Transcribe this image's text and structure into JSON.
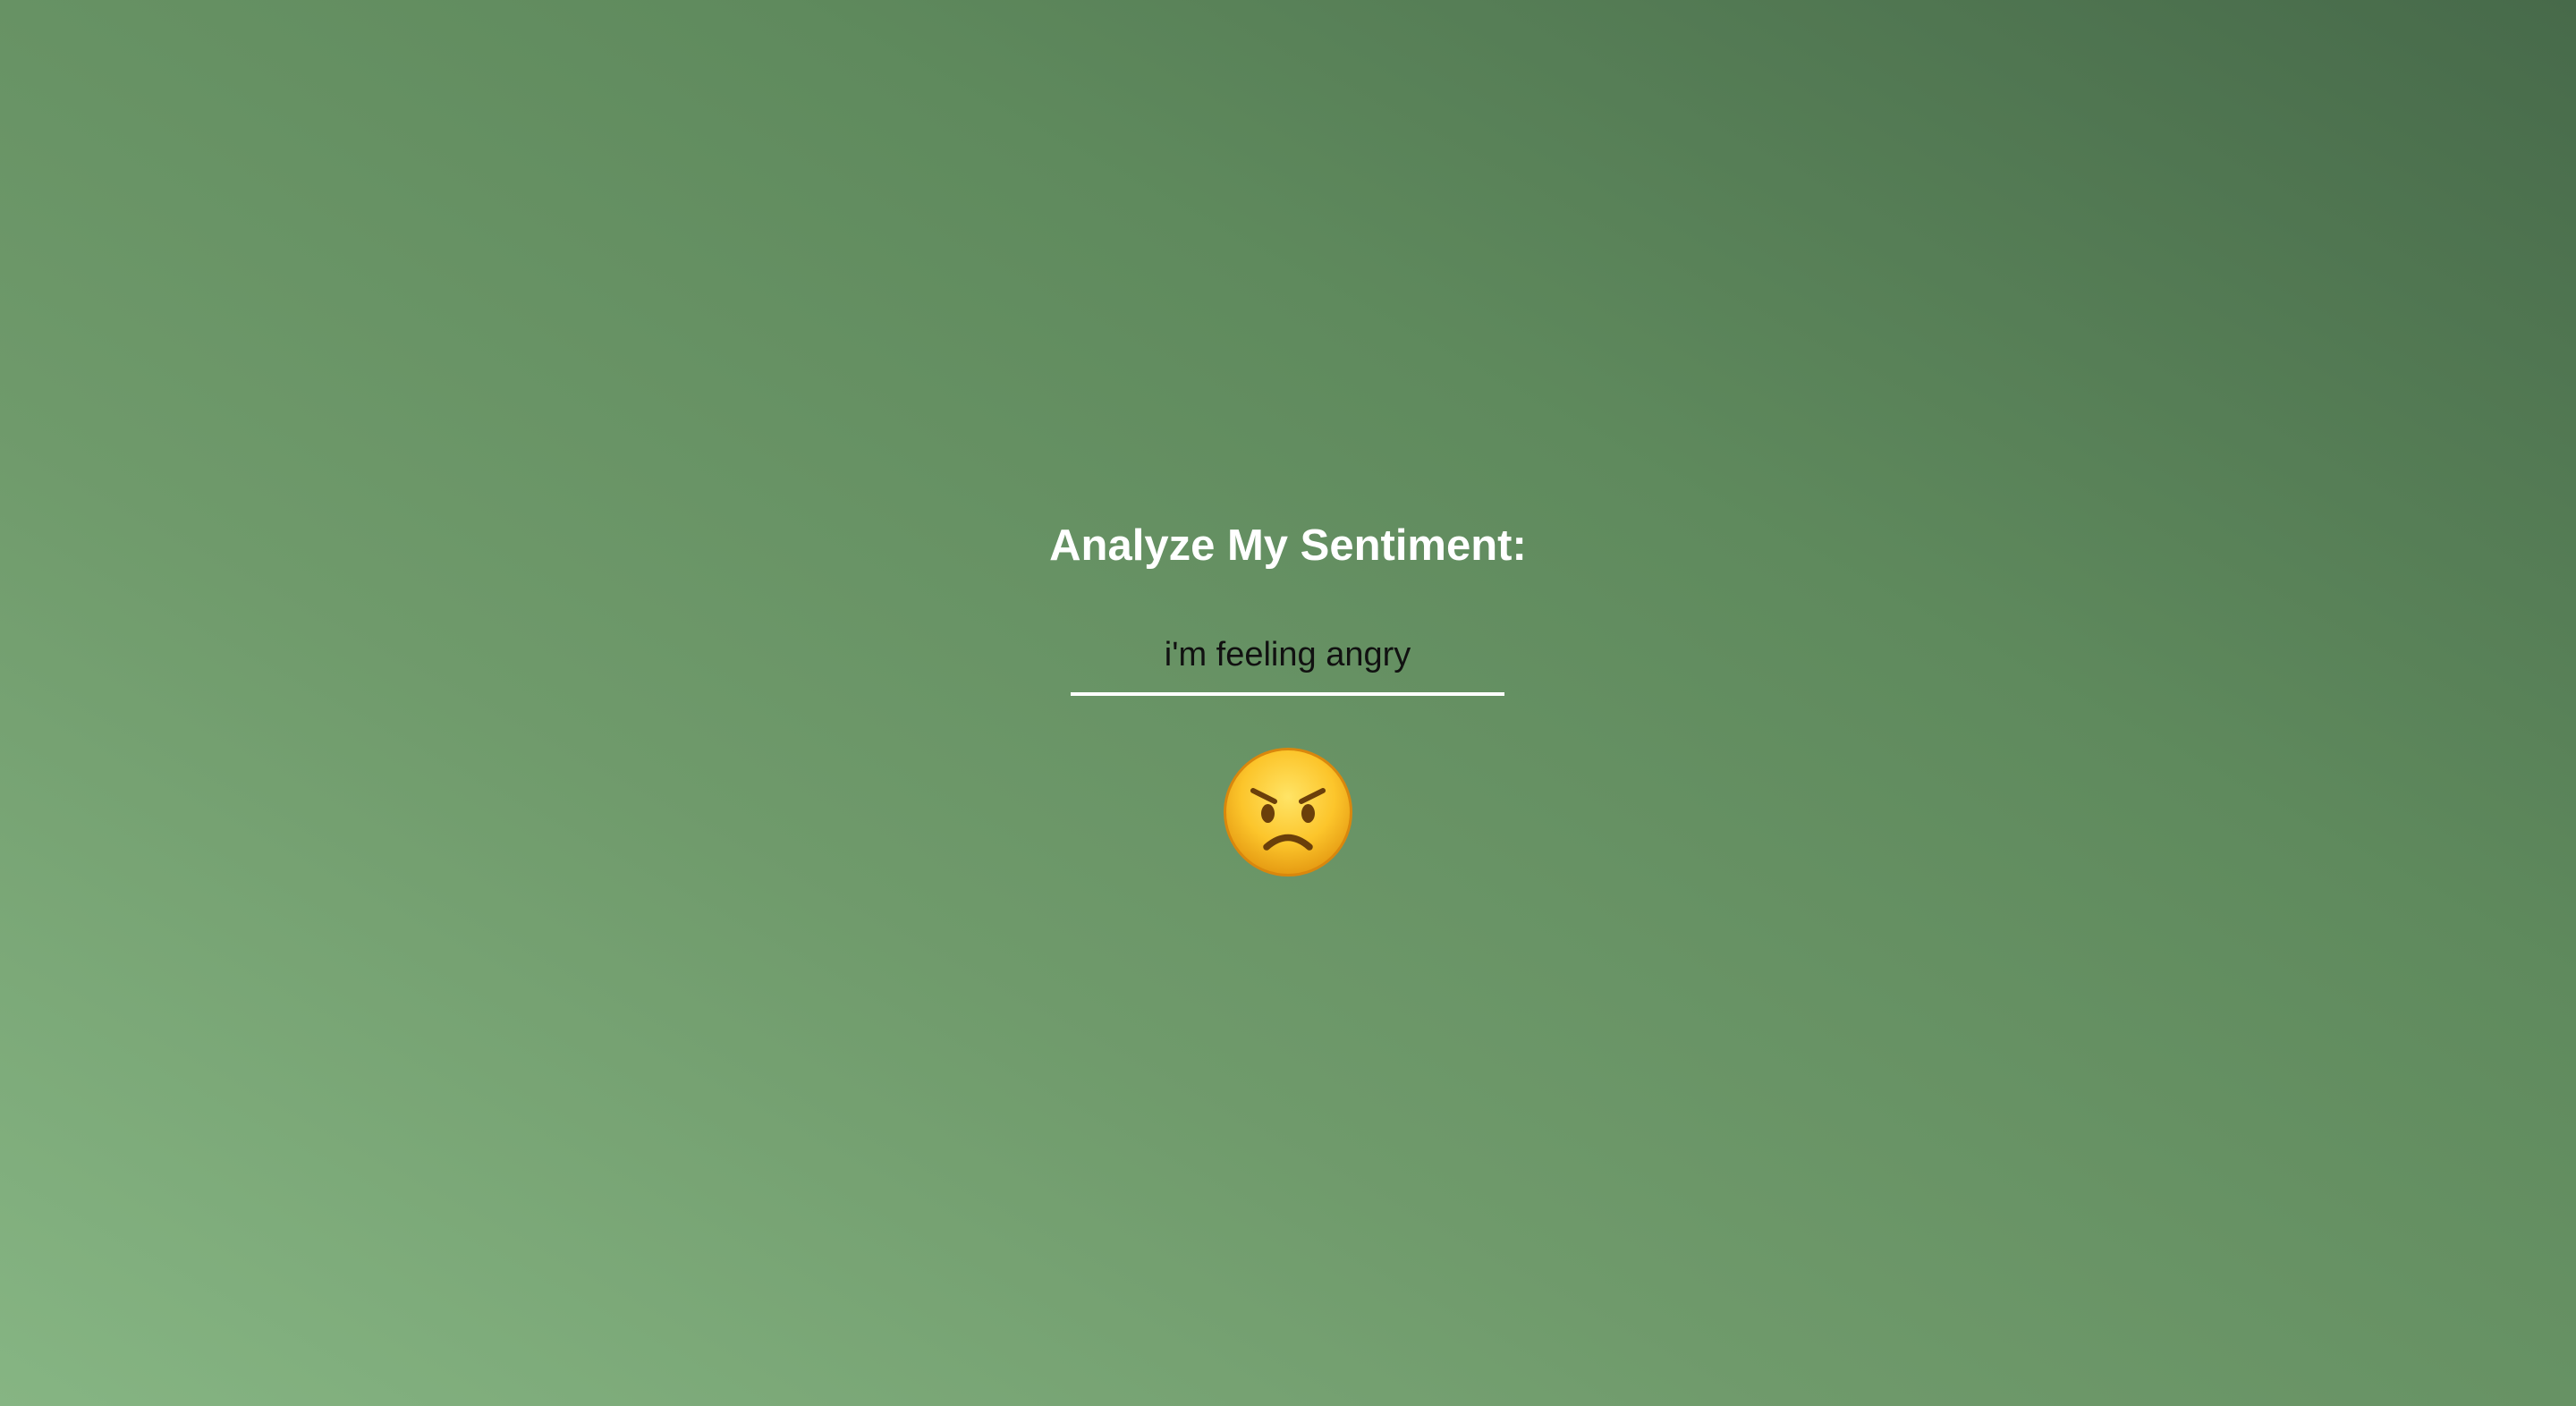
{
  "heading": "Analyze My Sentiment:",
  "input": {
    "value": "i'm feeling angry",
    "placeholder": ""
  },
  "result": {
    "emoji_icon": "angry-face-icon",
    "sentiment": "angry"
  },
  "colors": {
    "background_light": "#86b583",
    "background_dark": "#476a4a",
    "heading_text": "#ffffff",
    "underline": "#ffffff",
    "input_text": "#111111"
  }
}
